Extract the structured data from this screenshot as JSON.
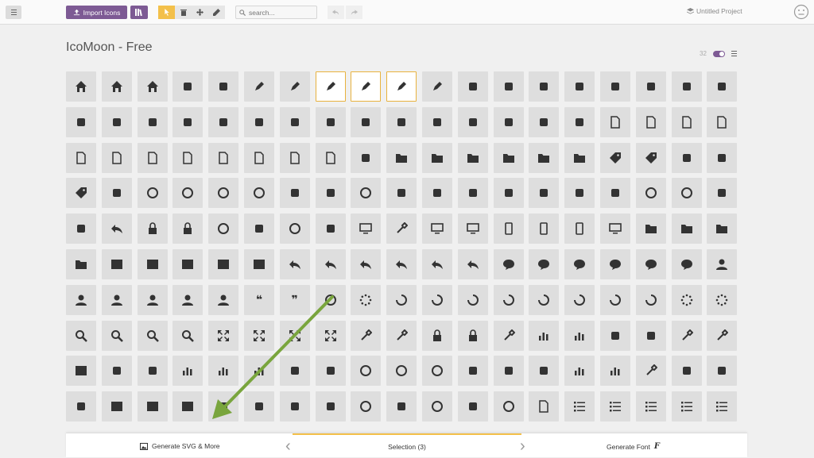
{
  "toolbar": {
    "import_label": "Import Icons",
    "search_placeholder": "search...",
    "project_name": "Untitled Project"
  },
  "set": {
    "title": "IcoMoon - Free",
    "count": "32"
  },
  "bottom": {
    "generate_svg": "Generate SVG & More",
    "selection": "Selection (3)",
    "generate_font": "Generate Font"
  },
  "colors": {
    "accent": "#7d5a94",
    "selection": "#f3c04a",
    "arrow": "#79a53d",
    "tile": "#dedede"
  },
  "icons": [
    "home",
    "home2",
    "home3",
    "office",
    "newspaper",
    "pencil",
    "pencil2",
    "quill",
    "pen",
    "blog",
    "eyedropper",
    "droplet",
    "paint-format",
    "image",
    "images",
    "camera",
    "headphones",
    "music",
    "play",
    "film",
    "video-camera",
    "dice",
    "pacman",
    "spades",
    "clubs",
    "diamonds",
    "bullhorn",
    "connection",
    "podcast",
    "feed",
    "mic",
    "book",
    "books",
    "library",
    "file-text",
    "profile",
    "file-empty",
    "files-empty",
    "file-text2",
    "file-picture",
    "file-music",
    "file-play",
    "file-video",
    "file-zip",
    "copy",
    "paste",
    "stack",
    "folder",
    "folder-open",
    "folder-plus",
    "folder-minus",
    "folder-download",
    "folder-upload",
    "price-tag",
    "price-tags",
    "barcode",
    "qrcode",
    "ticket",
    "cart",
    "coin-dollar",
    "coin-euro",
    "coin-pound",
    "coin-yen",
    "credit-card",
    "calculator",
    "lifebuoy",
    "phone",
    "phone-hang-up",
    "address-book",
    "envelop",
    "pushpin",
    "location",
    "location2",
    "compass",
    "compass2",
    "map",
    "map2",
    "history",
    "clock",
    "clock2",
    "alarm",
    "bell",
    "stopwatch",
    "calendar",
    "printer",
    "keyboard",
    "display",
    "laptop",
    "mobile",
    "mobile2",
    "tablet",
    "tv",
    "drawer",
    "drawer2",
    "box-add",
    "box-remove",
    "download",
    "upload",
    "floppy-disk",
    "drive",
    "database",
    "undo",
    "redo",
    "undo2",
    "redo2",
    "forward",
    "reply",
    "bubble",
    "bubbles",
    "bubbles2",
    "bubble2",
    "bubbles3",
    "bubbles4",
    "user",
    "users",
    "user-plus",
    "user-minus",
    "user-check",
    "user-tie",
    "quotes-left",
    "quotes-right",
    "hour-glass",
    "spinner",
    "spinner2",
    "spinner3",
    "spinner4",
    "spinner5",
    "spinner6",
    "spinner7",
    "spinner8",
    "spinner9",
    "spinner10",
    "spinner11",
    "binoculars",
    "search",
    "zoom-in",
    "zoom-out",
    "enlarge",
    "shrink",
    "enlarge2",
    "shrink2",
    "key",
    "key2",
    "lock",
    "unlocked",
    "wrench",
    "equalizer",
    "equalizer2",
    "cog",
    "cogs",
    "hammer",
    "magic-wand",
    "aid-kit",
    "bug",
    "pie-chart",
    "stats-dots",
    "stats-bars",
    "stats-bars2",
    "trophy",
    "gift",
    "glass",
    "glass2",
    "mug",
    "spoon-knife",
    "leaf",
    "rocket",
    "meter",
    "meter2",
    "hammer2",
    "fire",
    "lab",
    "magnet",
    "bin",
    "bin2",
    "briefcase",
    "airplane",
    "truck",
    "road",
    "accessibility",
    "target",
    "shield",
    "power",
    "switch",
    "power-cord",
    "clipboard",
    "list-numbered",
    "list",
    "list2",
    "tree",
    "menu"
  ],
  "selected_indices": [
    7,
    8,
    9
  ]
}
